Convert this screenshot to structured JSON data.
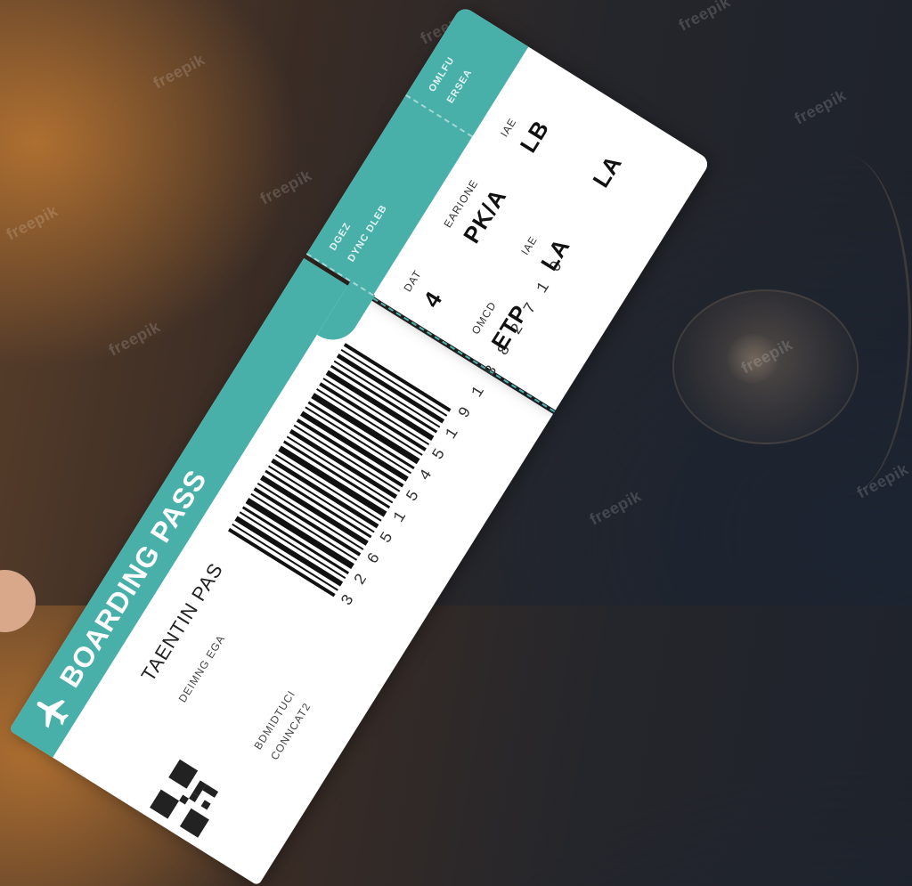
{
  "watermark": {
    "text": "freepik"
  },
  "ticket": {
    "title": "BOARDING PASS",
    "passenger_name": "TAENTIN PAS",
    "main_labels": [
      "DEIMNG EGA",
      "BDMIDTUCI",
      "CONNCAT2"
    ],
    "barcode_number": "3 2 6 5 1 5 4 5 1 9 1 8 8 2 7 1 0",
    "band_labels": [
      "DGEZ",
      "DYNC DLEB",
      "OMLFU",
      "ERSEA"
    ],
    "stub": {
      "fields": [
        {
          "label": "DAT",
          "value": "4"
        },
        {
          "label": "EARIONE",
          "value": "PK/A"
        },
        {
          "label": "IAE",
          "value": "LB"
        },
        {
          "label": "OMCD",
          "value": "ETP"
        },
        {
          "label": "IAE",
          "value": "LA"
        },
        {
          "label": "",
          "value": "LA"
        }
      ]
    }
  },
  "colors": {
    "accent": "#48b0a9",
    "paper": "#ffffff"
  },
  "icons": {
    "plane": "airplane-icon",
    "barcode": "barcode",
    "qr": "qr-code"
  }
}
